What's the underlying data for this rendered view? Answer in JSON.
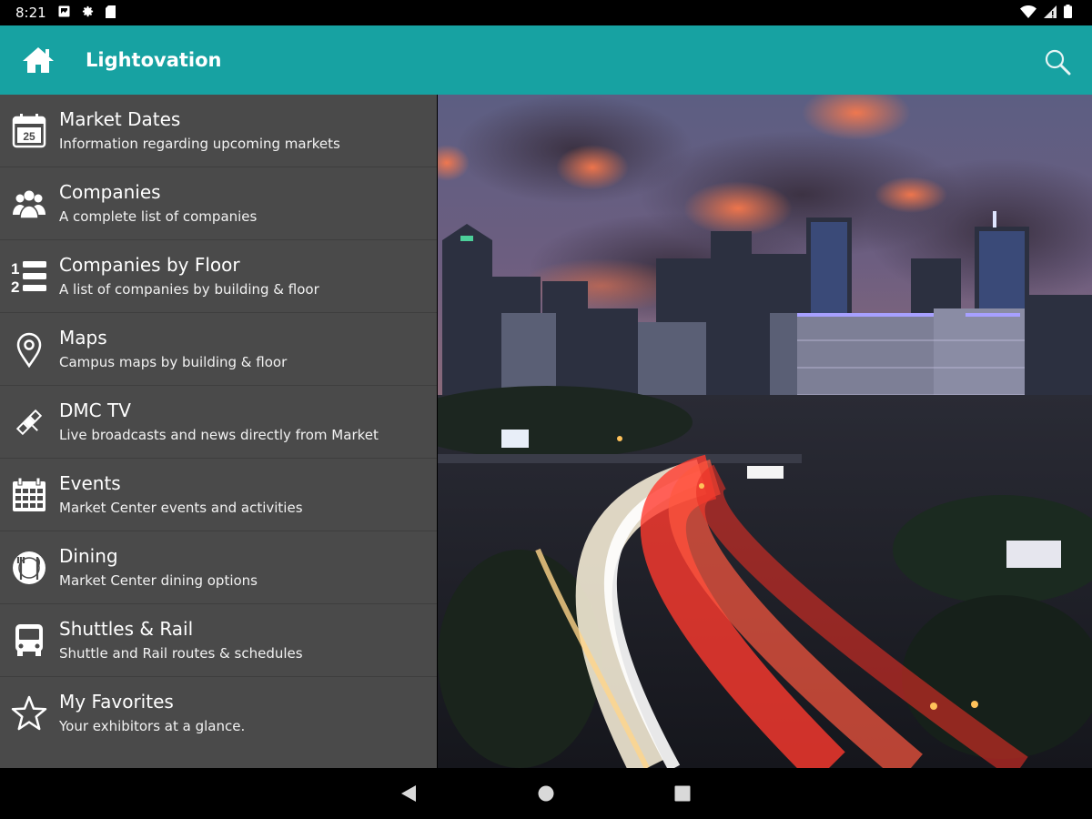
{
  "status_bar": {
    "time": "8:21"
  },
  "app_bar": {
    "title": "Lightovation"
  },
  "menu": {
    "items": [
      {
        "title": "Market Dates",
        "subtitle": "Information regarding upcoming markets",
        "icon": "calendar-icon"
      },
      {
        "title": "Companies",
        "subtitle": "A complete list of companies",
        "icon": "people-icon"
      },
      {
        "title": "Companies by Floor",
        "subtitle": "A list of companies by building & floor",
        "icon": "numbered-list-icon"
      },
      {
        "title": "Maps",
        "subtitle": "Campus maps by building & floor",
        "icon": "map-pin-icon"
      },
      {
        "title": "DMC TV",
        "subtitle": "Live broadcasts and news directly from Market",
        "icon": "satellite-icon"
      },
      {
        "title": "Events",
        "subtitle": "Market Center events and activities",
        "icon": "calendar-grid-icon"
      },
      {
        "title": "Dining",
        "subtitle": "Market Center dining options",
        "icon": "dining-icon"
      },
      {
        "title": "Shuttles & Rail",
        "subtitle": "Shuttle and Rail routes & schedules",
        "icon": "bus-icon"
      },
      {
        "title": "My Favorites",
        "subtitle": "Your exhibitors at a glance.",
        "icon": "star-icon"
      }
    ]
  },
  "colors": {
    "app_bar": "#17a2a2",
    "menu_bg": "#4a4a4a",
    "text": "#ffffff"
  }
}
